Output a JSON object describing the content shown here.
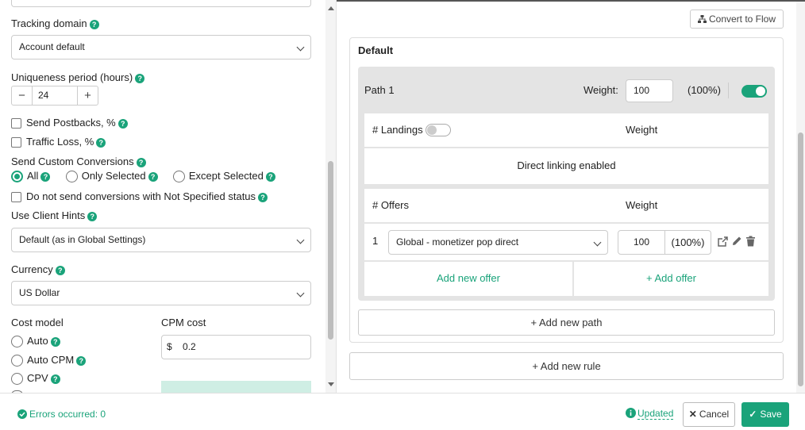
{
  "left": {
    "tracking_domain": {
      "label": "Tracking domain",
      "value": "Account default"
    },
    "uniqueness": {
      "label": "Uniqueness period (hours)",
      "value": "24",
      "minus": "−",
      "plus": "+"
    },
    "send_postbacks": {
      "label": "Send Postbacks, %"
    },
    "traffic_loss": {
      "label": "Traffic Loss, %"
    },
    "custom_conversions": {
      "label": "Send Custom Conversions",
      "options": [
        "All",
        "Only Selected",
        "Except Selected"
      ],
      "selected": "All"
    },
    "not_specified": {
      "label": "Do not send conversions with Not Specified status"
    },
    "client_hints": {
      "label": "Use Client Hints",
      "value": "Default (as in Global Settings)"
    },
    "currency": {
      "label": "Currency",
      "value": "US Dollar"
    },
    "cost_model": {
      "label": "Cost model",
      "options": [
        "Auto",
        "Auto CPM",
        "CPV"
      ]
    },
    "cpm_cost": {
      "label": "CPM cost",
      "currency_symbol": "$",
      "value": "0.2"
    }
  },
  "right": {
    "convert_to_flow": "Convert to Flow",
    "rule_title": "Default",
    "path": {
      "name": "Path 1",
      "weight_label": "Weight:",
      "weight_value": "100",
      "weight_pct": "(100%)",
      "enabled": true
    },
    "landings": {
      "header": "# Landings",
      "weight_header": "Weight",
      "toggle_on": false,
      "message": "Direct linking enabled"
    },
    "offers": {
      "header": "# Offers",
      "weight_header": "Weight",
      "rows": [
        {
          "index": "1",
          "name": "Global - monetizer pop direct",
          "weight": "100",
          "pct": "(100%)"
        }
      ],
      "add_new_offer": "Add new offer",
      "add_offer": "+ Add offer"
    },
    "add_new_path": "+ Add new path",
    "add_new_rule": "+ Add new rule"
  },
  "footer": {
    "errors": "Errors occurred: 0",
    "updated": "Updated",
    "cancel": "Cancel",
    "save": "Save"
  },
  "colors": {
    "accent": "#1aa37a",
    "path_bg": "#e4e4e4"
  }
}
